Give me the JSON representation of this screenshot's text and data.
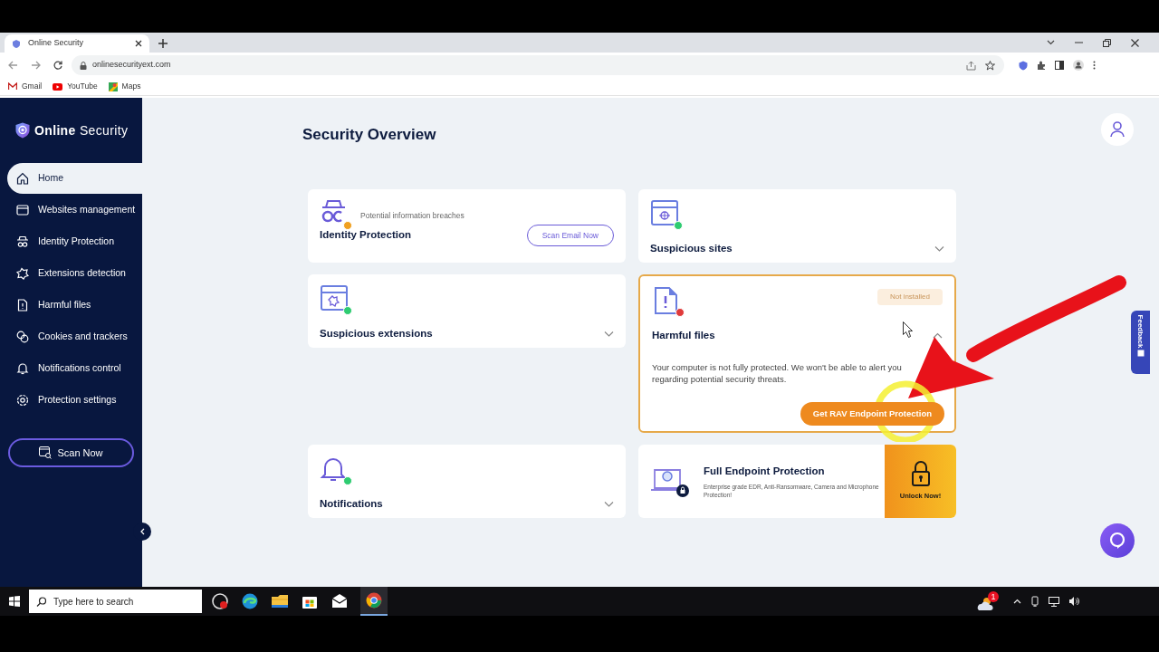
{
  "browser": {
    "tab_title": "Online Security",
    "url": "onlinesecurityext.com",
    "bookmarks": [
      "Gmail",
      "YouTube",
      "Maps"
    ]
  },
  "sidebar": {
    "brand": "**Online** Security",
    "items": [
      {
        "label": "Home",
        "selected": true
      },
      {
        "label": "Websites management",
        "selected": false
      },
      {
        "label": "Identity Protection",
        "selected": false
      },
      {
        "label": "Extensions detection",
        "selected": false
      },
      {
        "label": "Harmful files",
        "selected": false
      },
      {
        "label": "Cookies and trackers",
        "selected": false
      },
      {
        "label": "Notifications control",
        "selected": false
      },
      {
        "label": "Protection settings",
        "selected": false
      }
    ],
    "scan_button": "Scan Now"
  },
  "page_title": "Security Overview",
  "cards": [
    {
      "kind": "action",
      "title": "Identity Protection",
      "color": "#f0a020",
      "subtitle": "Potential information breaches",
      "button": "Scan Email Now"
    },
    {
      "kind": "collapsible",
      "title": "Suspicious sites",
      "color": "#2ecc71",
      "expanded": false
    },
    {
      "kind": "collapsible",
      "title": "Suspicious extensions",
      "color": "#2ecc71",
      "expanded": false
    },
    {
      "kind": "collapsible",
      "title": "Harmful files",
      "color": "#e03b3b",
      "expanded": true,
      "tag": "Not installed",
      "body": "Your computer is not fully protected. We won't be able to alert you regarding potential security threats.",
      "button": "Get RAV Endpoint Protection"
    },
    {
      "kind": "collapsible",
      "title": "Notifications",
      "color": "#2ecc71",
      "expanded": false
    },
    {
      "kind": "promo",
      "title": "Full Endpoint Protection",
      "description": "Enterprise grade EDR, Anti-Ransomware, Camera and Microphone Protection!",
      "button": "Unlock Now!"
    }
  ],
  "feedback_tab": "Feedback",
  "taskbar": {
    "search_placeholder": "Type here to search",
    "weather_badge": "1"
  }
}
